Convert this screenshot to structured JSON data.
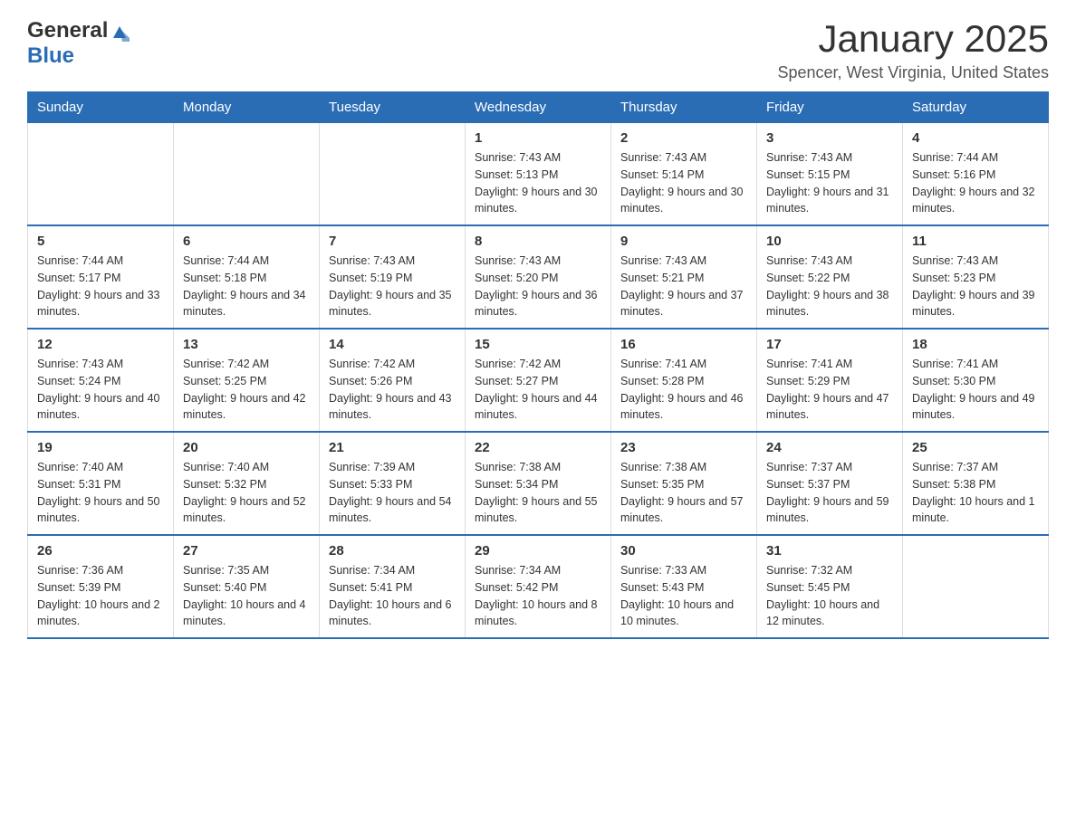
{
  "header": {
    "logo_general": "General",
    "logo_blue": "Blue",
    "month_title": "January 2025",
    "location": "Spencer, West Virginia, United States"
  },
  "weekdays": [
    "Sunday",
    "Monday",
    "Tuesday",
    "Wednesday",
    "Thursday",
    "Friday",
    "Saturday"
  ],
  "weeks": [
    [
      {
        "day": "",
        "info": ""
      },
      {
        "day": "",
        "info": ""
      },
      {
        "day": "",
        "info": ""
      },
      {
        "day": "1",
        "info": "Sunrise: 7:43 AM\nSunset: 5:13 PM\nDaylight: 9 hours and 30 minutes."
      },
      {
        "day": "2",
        "info": "Sunrise: 7:43 AM\nSunset: 5:14 PM\nDaylight: 9 hours and 30 minutes."
      },
      {
        "day": "3",
        "info": "Sunrise: 7:43 AM\nSunset: 5:15 PM\nDaylight: 9 hours and 31 minutes."
      },
      {
        "day": "4",
        "info": "Sunrise: 7:44 AM\nSunset: 5:16 PM\nDaylight: 9 hours and 32 minutes."
      }
    ],
    [
      {
        "day": "5",
        "info": "Sunrise: 7:44 AM\nSunset: 5:17 PM\nDaylight: 9 hours and 33 minutes."
      },
      {
        "day": "6",
        "info": "Sunrise: 7:44 AM\nSunset: 5:18 PM\nDaylight: 9 hours and 34 minutes."
      },
      {
        "day": "7",
        "info": "Sunrise: 7:43 AM\nSunset: 5:19 PM\nDaylight: 9 hours and 35 minutes."
      },
      {
        "day": "8",
        "info": "Sunrise: 7:43 AM\nSunset: 5:20 PM\nDaylight: 9 hours and 36 minutes."
      },
      {
        "day": "9",
        "info": "Sunrise: 7:43 AM\nSunset: 5:21 PM\nDaylight: 9 hours and 37 minutes."
      },
      {
        "day": "10",
        "info": "Sunrise: 7:43 AM\nSunset: 5:22 PM\nDaylight: 9 hours and 38 minutes."
      },
      {
        "day": "11",
        "info": "Sunrise: 7:43 AM\nSunset: 5:23 PM\nDaylight: 9 hours and 39 minutes."
      }
    ],
    [
      {
        "day": "12",
        "info": "Sunrise: 7:43 AM\nSunset: 5:24 PM\nDaylight: 9 hours and 40 minutes."
      },
      {
        "day": "13",
        "info": "Sunrise: 7:42 AM\nSunset: 5:25 PM\nDaylight: 9 hours and 42 minutes."
      },
      {
        "day": "14",
        "info": "Sunrise: 7:42 AM\nSunset: 5:26 PM\nDaylight: 9 hours and 43 minutes."
      },
      {
        "day": "15",
        "info": "Sunrise: 7:42 AM\nSunset: 5:27 PM\nDaylight: 9 hours and 44 minutes."
      },
      {
        "day": "16",
        "info": "Sunrise: 7:41 AM\nSunset: 5:28 PM\nDaylight: 9 hours and 46 minutes."
      },
      {
        "day": "17",
        "info": "Sunrise: 7:41 AM\nSunset: 5:29 PM\nDaylight: 9 hours and 47 minutes."
      },
      {
        "day": "18",
        "info": "Sunrise: 7:41 AM\nSunset: 5:30 PM\nDaylight: 9 hours and 49 minutes."
      }
    ],
    [
      {
        "day": "19",
        "info": "Sunrise: 7:40 AM\nSunset: 5:31 PM\nDaylight: 9 hours and 50 minutes."
      },
      {
        "day": "20",
        "info": "Sunrise: 7:40 AM\nSunset: 5:32 PM\nDaylight: 9 hours and 52 minutes."
      },
      {
        "day": "21",
        "info": "Sunrise: 7:39 AM\nSunset: 5:33 PM\nDaylight: 9 hours and 54 minutes."
      },
      {
        "day": "22",
        "info": "Sunrise: 7:38 AM\nSunset: 5:34 PM\nDaylight: 9 hours and 55 minutes."
      },
      {
        "day": "23",
        "info": "Sunrise: 7:38 AM\nSunset: 5:35 PM\nDaylight: 9 hours and 57 minutes."
      },
      {
        "day": "24",
        "info": "Sunrise: 7:37 AM\nSunset: 5:37 PM\nDaylight: 9 hours and 59 minutes."
      },
      {
        "day": "25",
        "info": "Sunrise: 7:37 AM\nSunset: 5:38 PM\nDaylight: 10 hours and 1 minute."
      }
    ],
    [
      {
        "day": "26",
        "info": "Sunrise: 7:36 AM\nSunset: 5:39 PM\nDaylight: 10 hours and 2 minutes."
      },
      {
        "day": "27",
        "info": "Sunrise: 7:35 AM\nSunset: 5:40 PM\nDaylight: 10 hours and 4 minutes."
      },
      {
        "day": "28",
        "info": "Sunrise: 7:34 AM\nSunset: 5:41 PM\nDaylight: 10 hours and 6 minutes."
      },
      {
        "day": "29",
        "info": "Sunrise: 7:34 AM\nSunset: 5:42 PM\nDaylight: 10 hours and 8 minutes."
      },
      {
        "day": "30",
        "info": "Sunrise: 7:33 AM\nSunset: 5:43 PM\nDaylight: 10 hours and 10 minutes."
      },
      {
        "day": "31",
        "info": "Sunrise: 7:32 AM\nSunset: 5:45 PM\nDaylight: 10 hours and 12 minutes."
      },
      {
        "day": "",
        "info": ""
      }
    ]
  ]
}
